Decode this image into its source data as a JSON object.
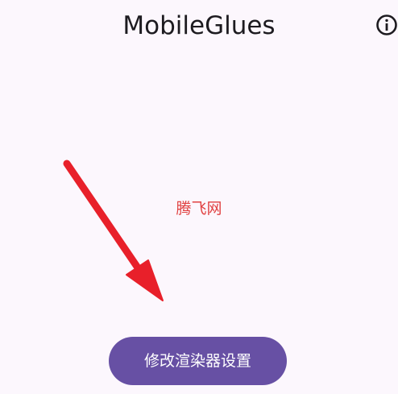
{
  "app_bar": {
    "title": "MobileGlues",
    "info_icon": "info-icon"
  },
  "watermark": {
    "text": "腾飞网"
  },
  "annotation": {
    "icon": "red-arrow-icon",
    "color": "#e8202a"
  },
  "main": {
    "button_label": "修改渲染器设置"
  },
  "colors": {
    "background": "#fcf7fd",
    "primary": "#6750a4",
    "on_primary": "#ffffff",
    "title_text": "#1d1b20",
    "watermark": "#e14242"
  }
}
